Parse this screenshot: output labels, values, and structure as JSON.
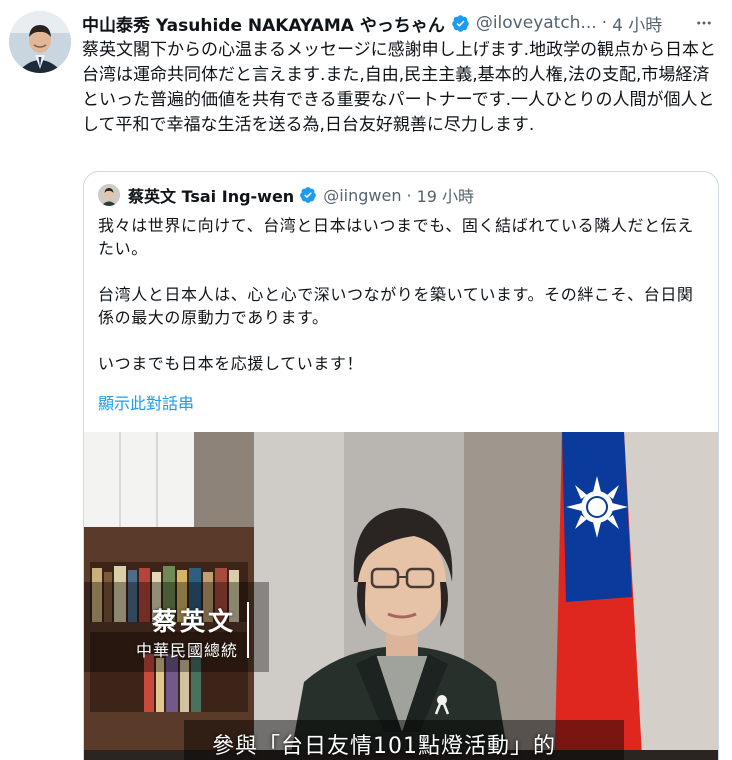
{
  "tweet": {
    "display_name": "中山泰秀 Yasuhide NAKAYAMA やっちゃん",
    "handle": "@iloveyatch...",
    "separator": "·",
    "time": "4 小時",
    "text": "蔡英文閣下からの心温まるメッセージに感謝申し上げます.地政学の観点から日本と台湾は運命共同体だと言えます.また,自由,民主主義,基本的人権,法の支配,市場経済といった普遍的価値を共有できる重要なパートナーです.一人ひとりの人間が個人として平和で幸福な生活を送る為,日台友好親善に尽力します."
  },
  "quote": {
    "display_name": "蔡英文 Tsai Ing-wen",
    "handle": "@iingwen",
    "separator": "·",
    "time": "19 小時",
    "text": "我々は世界に向けて、台湾と日本はいつまでも、固く結ばれている隣人だと伝えたい。\n\n台湾人と日本人は、心と心で深いつながりを築いています。その絆こそ、台日関係の最大の原動力であります。\n\nいつまでも日本を応援しています！",
    "show_thread": "顯示此對話串"
  },
  "video": {
    "caption_name": "蔡英文",
    "caption_role": "中華民國總統",
    "subtitle": "參與「台日友情101點燈活動」的"
  },
  "icons": {
    "verified": "verified-badge-icon",
    "more": "more-options-icon"
  },
  "colors": {
    "link": "#1d9bf0",
    "secondary_text": "#536471",
    "verified": "#1d9bf0",
    "flag_red": "#e0271f",
    "flag_blue": "#0a3a9c"
  }
}
